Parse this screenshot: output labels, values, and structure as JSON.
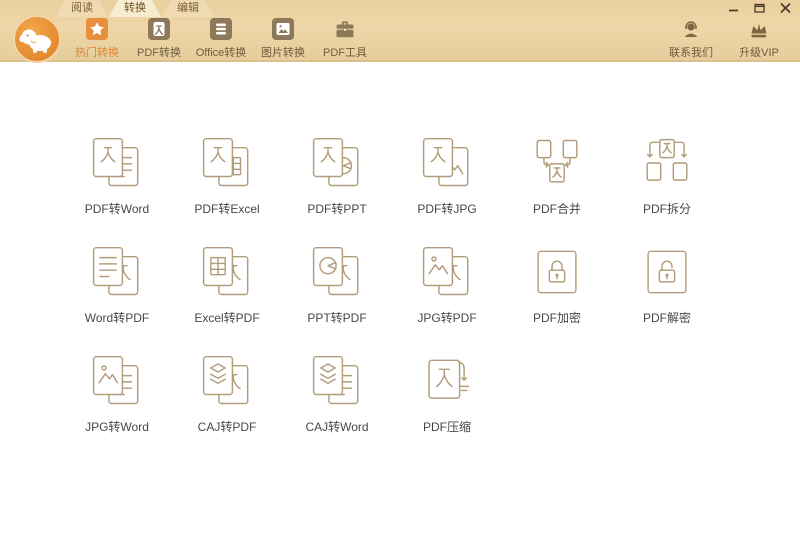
{
  "tabs": {
    "items": [
      {
        "label": "阅读",
        "active": false
      },
      {
        "label": "转换",
        "active": true
      },
      {
        "label": "编辑",
        "active": false
      }
    ]
  },
  "toolbar": {
    "items": [
      {
        "label": "热门转换",
        "icon": "star-icon",
        "active": true
      },
      {
        "label": "PDF转换",
        "icon": "pdf-file-icon",
        "active": false
      },
      {
        "label": "Office转换",
        "icon": "office-doc-icon",
        "active": false
      },
      {
        "label": "图片转换",
        "icon": "image-file-icon",
        "active": false
      },
      {
        "label": "PDF工具",
        "icon": "briefcase-icon",
        "active": false
      }
    ]
  },
  "header_right": {
    "items": [
      {
        "label": "联系我们",
        "icon": "headset-person-icon"
      },
      {
        "label": "升级VIP",
        "icon": "crown-icon"
      }
    ]
  },
  "window_controls": {
    "items": [
      "minimize",
      "maximize",
      "close"
    ]
  },
  "features": {
    "items": [
      {
        "label": "PDF转Word",
        "icon": "pdf-to-word"
      },
      {
        "label": "PDF转Excel",
        "icon": "pdf-to-excel"
      },
      {
        "label": "PDF转PPT",
        "icon": "pdf-to-ppt"
      },
      {
        "label": "PDF转JPG",
        "icon": "pdf-to-jpg"
      },
      {
        "label": "PDF合并",
        "icon": "pdf-merge"
      },
      {
        "label": "PDF拆分",
        "icon": "pdf-split"
      },
      {
        "label": "Word转PDF",
        "icon": "word-to-pdf"
      },
      {
        "label": "Excel转PDF",
        "icon": "excel-to-pdf"
      },
      {
        "label": "PPT转PDF",
        "icon": "ppt-to-pdf"
      },
      {
        "label": "JPG转PDF",
        "icon": "jpg-to-pdf"
      },
      {
        "label": "PDF加密",
        "icon": "pdf-encrypt"
      },
      {
        "label": "PDF解密",
        "icon": "pdf-decrypt"
      },
      {
        "label": "JPG转Word",
        "icon": "jpg-to-word"
      },
      {
        "label": "CAJ转PDF",
        "icon": "caj-to-pdf"
      },
      {
        "label": "CAJ转Word",
        "icon": "caj-to-word"
      },
      {
        "label": "PDF压缩",
        "icon": "pdf-compress"
      }
    ]
  },
  "colors": {
    "accent_orange": "#e78f3c",
    "header_tan": "#e8d0a0",
    "header_border": "#ddc089",
    "badge_brown": "#8d7859",
    "icon_stroke": "#b39c7b",
    "grid_label": "#474747",
    "tab_text": "#7e6239",
    "toolbar_label": "#6f5b3e",
    "window_control": "#4a3a26"
  }
}
